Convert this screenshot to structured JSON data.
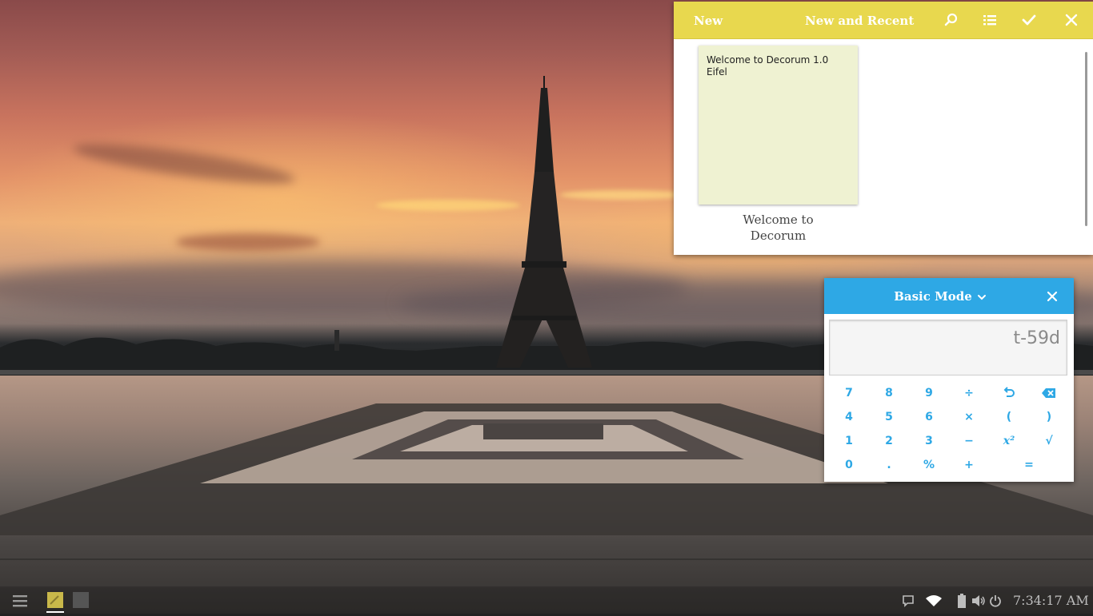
{
  "notes": {
    "new_label": "New",
    "title": "New and Recent",
    "header_icons": [
      "search-icon",
      "list-icon",
      "check-icon",
      "close-icon"
    ],
    "accent": "#e8d84e",
    "items": [
      {
        "text": "Welcome to Decorum 1.0\nEifel",
        "caption": "Welcome to\nDecorum"
      }
    ]
  },
  "calculator": {
    "mode": "Basic Mode",
    "display": "t-59d",
    "accent": "#2ea8e5",
    "keys": [
      [
        "7",
        "8",
        "9",
        "÷",
        "undo-icon",
        "backspace-icon"
      ],
      [
        "4",
        "5",
        "6",
        "×",
        "(",
        ")"
      ],
      [
        "1",
        "2",
        "3",
        "−",
        "x²",
        "√"
      ],
      [
        "0",
        ".",
        "%",
        "+",
        "="
      ]
    ]
  },
  "taskbar": {
    "clock": "7:34:17 AM",
    "tray_icons": [
      "chat-icon",
      "wifi-icon",
      "battery-icon",
      "volume-icon",
      "power-icon"
    ]
  }
}
